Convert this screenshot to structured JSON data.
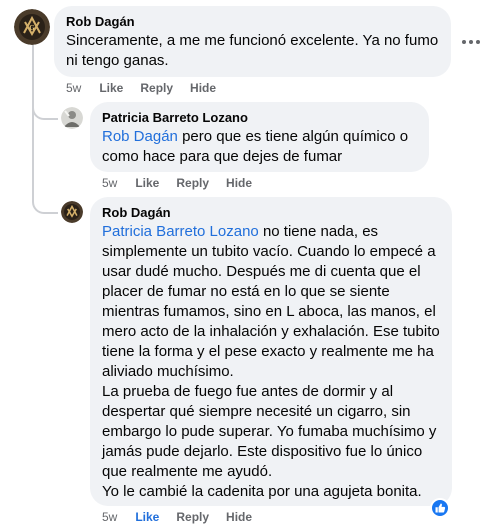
{
  "comments": [
    {
      "author": "Rob Dagán",
      "text": "Sinceramente, a me me funcionó excelente. Ya no fumo ni tengo ganas.",
      "time": "5w",
      "like": "Like",
      "reply": "Reply",
      "hide": "Hide",
      "avatar_icon": "masonic-emblem-avatar"
    },
    {
      "author": "Patricia Barreto Lozano",
      "mention": "Rob Dagán",
      "text": "pero que es tiene algún químico o como hace para que dejes de fumar",
      "time": "5w",
      "like": "Like",
      "reply": "Reply",
      "hide": "Hide",
      "avatar_icon": "person-photo-avatar"
    },
    {
      "author": "Rob Dagán",
      "mention": "Patricia Barreto Lozano",
      "text_p1": "no tiene nada, es simplemente un tubito vacío. Cuando lo empecé a usar dudé mucho. Después me di cuenta que el placer de fumar no está en lo que se siente mientras fumamos, sino en L aboca, las manos, el mero acto de la inhalación y exhalación. Ese tubito tiene la forma y el pese exacto y realmente me ha aliviado muchísimo.",
      "text_p2": "La prueba de fuego fue antes de dormir y al despertar qué siempre necesité un cigarro, sin embargo lo pude superar. Yo fumaba muchísimo y jamás pude dejarlo. Este dispositivo fue lo único que realmente me ayudó.",
      "text_p3": "Yo le cambié la cadenita por una agujeta bonita.",
      "time": "5w",
      "like": "Like",
      "reply": "Reply",
      "hide": "Hide",
      "avatar_icon": "masonic-emblem-avatar",
      "reaction_icon": "thumbs-up-icon",
      "reaction_color": "#1877f2"
    }
  ],
  "colors": {
    "bubble": "#f0f2f5",
    "mention": "#216fdb",
    "meta": "#65676b"
  },
  "more_icon": "more-options-icon"
}
